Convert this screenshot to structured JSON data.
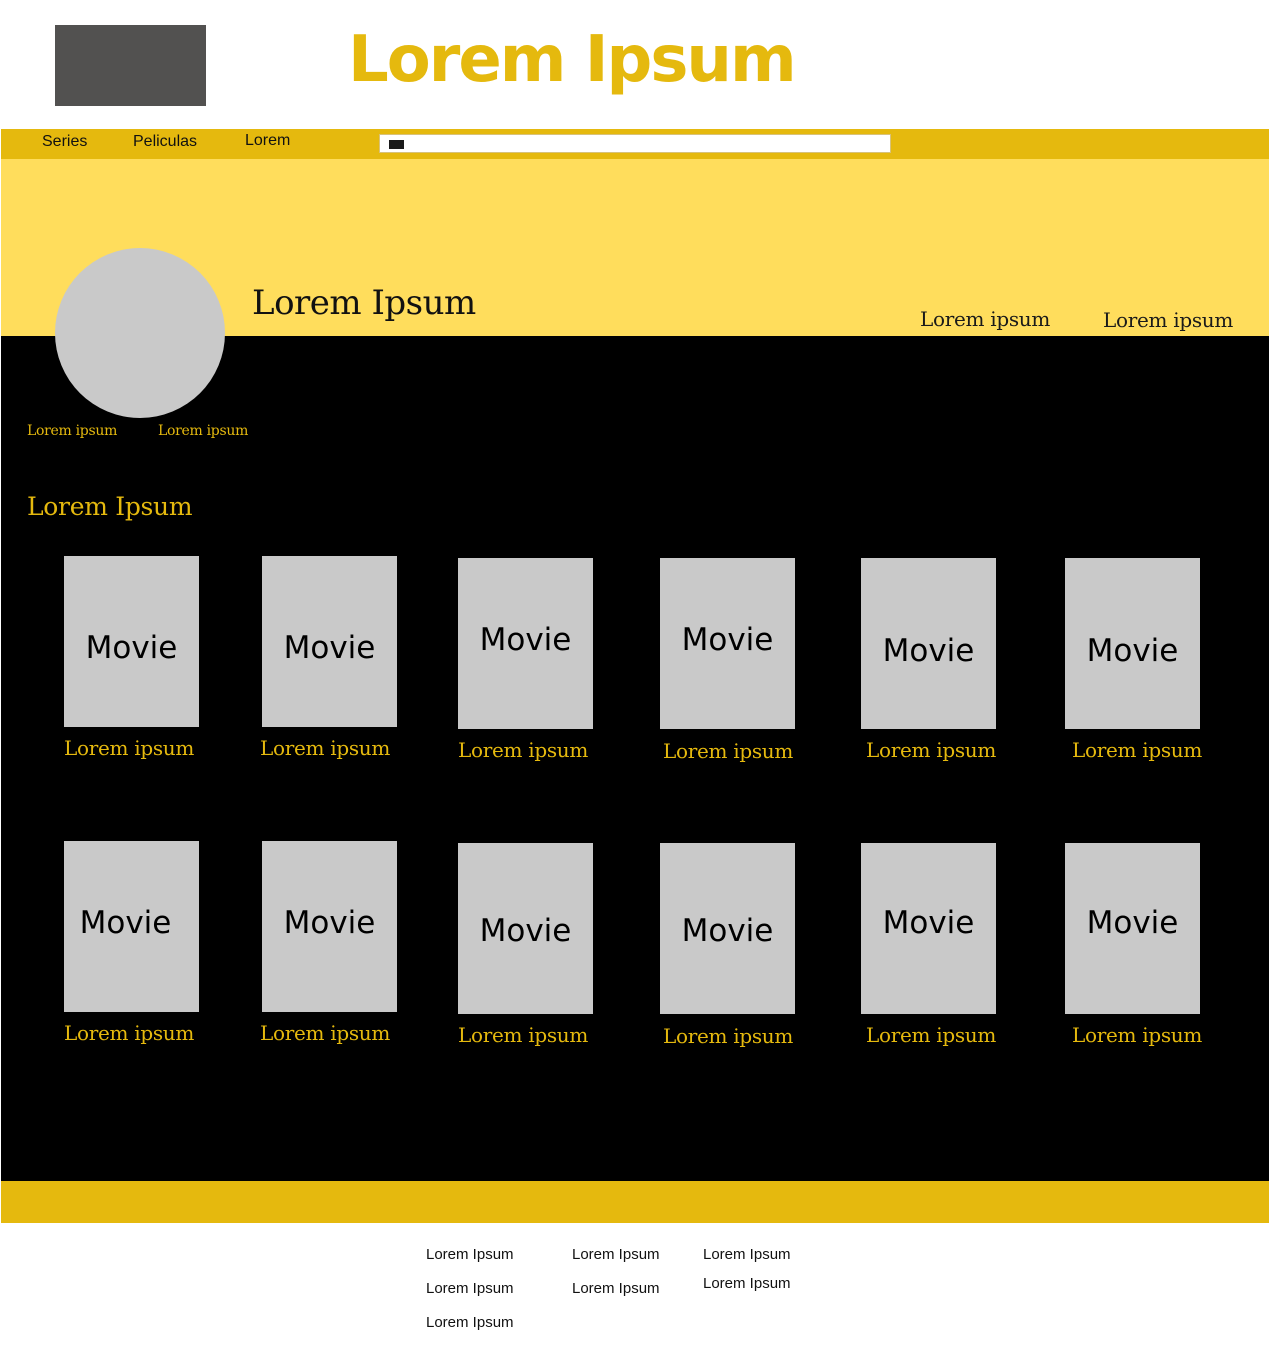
{
  "header": {
    "site_title": "Lorem Ipsum",
    "logo_color": "#525150",
    "accent_color": "#e5b90e"
  },
  "nav": {
    "items": [
      "Series",
      "Peliculas",
      "Lorem"
    ],
    "search_placeholder": ""
  },
  "profile": {
    "name": "Lorem Ipsum",
    "banner_links": [
      "Lorem ipsum",
      "Lorem ipsum"
    ],
    "sub_links": [
      "Lorem ipsum",
      "Lorem ipsum"
    ],
    "banner_color": "#ffdd5c"
  },
  "section": {
    "title": "Lorem Ipsum"
  },
  "movies": {
    "row1": [
      {
        "poster": "Movie",
        "caption": "Lorem ipsum"
      },
      {
        "poster": "Movie",
        "caption": "Lorem ipsum"
      },
      {
        "poster": "Movie",
        "caption": "Lorem ipsum"
      },
      {
        "poster": "Movie",
        "caption": "Lorem ipsum"
      },
      {
        "poster": "Movie",
        "caption": "Lorem ipsum"
      },
      {
        "poster": "Movie",
        "caption": "Lorem ipsum"
      }
    ],
    "row2": [
      {
        "poster": "Movie",
        "caption": "Lorem ipsum"
      },
      {
        "poster": "Movie",
        "caption": "Lorem ipsum"
      },
      {
        "poster": "Movie",
        "caption": "Lorem ipsum"
      },
      {
        "poster": "Movie",
        "caption": "Lorem ipsum"
      },
      {
        "poster": "Movie",
        "caption": "Lorem ipsum"
      },
      {
        "poster": "Movie",
        "caption": "Lorem ipsum"
      }
    ]
  },
  "footer": {
    "col1": [
      "Lorem Ipsum",
      "Lorem Ipsum",
      "Lorem Ipsum"
    ],
    "col2": [
      "Lorem Ipsum",
      "Lorem Ipsum"
    ],
    "col3": [
      "Lorem Ipsum",
      "Lorem Ipsum"
    ]
  }
}
